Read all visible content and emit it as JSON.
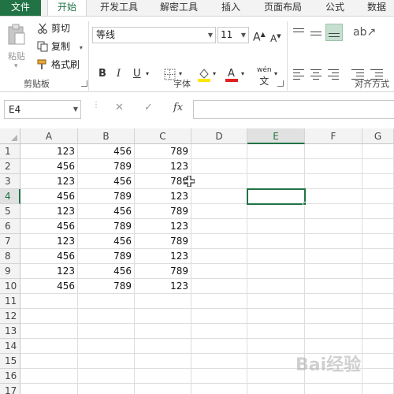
{
  "tabs": [
    {
      "label": "文件"
    },
    {
      "label": "开始"
    },
    {
      "label": "开发工具"
    },
    {
      "label": "解密工具"
    },
    {
      "label": "插入"
    },
    {
      "label": "页面布局"
    },
    {
      "label": "公式"
    },
    {
      "label": "数据"
    }
  ],
  "ribbon": {
    "clipboard": {
      "paste_label": "粘贴",
      "cut_label": "剪切",
      "copy_label": "复制",
      "format_painter_label": "格式刷",
      "group_label": "剪贴板"
    },
    "font": {
      "font_name": "等线",
      "font_size": "11",
      "grow_label": "A",
      "shrink_label": "A",
      "bold": "B",
      "italic": "I",
      "underline": "U",
      "phonetic": "wén",
      "group_label": "字体"
    },
    "alignment": {
      "group_label": "对齐方式"
    }
  },
  "formula_bar": {
    "name_box": "E4",
    "fx_label": "fx",
    "formula": ""
  },
  "sheet": {
    "columns": [
      "A",
      "B",
      "C",
      "D",
      "E",
      "F",
      "G"
    ],
    "rows": [
      "1",
      "2",
      "3",
      "4",
      "5",
      "6",
      "7",
      "8",
      "9",
      "10",
      "11",
      "12",
      "13",
      "14",
      "15",
      "16",
      "17"
    ],
    "data": [
      [
        "123",
        "456",
        "789"
      ],
      [
        "456",
        "789",
        "123"
      ],
      [
        "123",
        "456",
        "789"
      ],
      [
        "456",
        "789",
        "123"
      ],
      [
        "123",
        "456",
        "789"
      ],
      [
        "456",
        "789",
        "123"
      ],
      [
        "123",
        "456",
        "789"
      ],
      [
        "456",
        "789",
        "123"
      ],
      [
        "123",
        "456",
        "789"
      ],
      [
        "456",
        "789",
        "123"
      ]
    ],
    "active_cell": "E4"
  },
  "colors": {
    "accent": "#217346",
    "font_color": "#e02020",
    "highlight": "#ffe600"
  },
  "watermark": "Bai经验"
}
